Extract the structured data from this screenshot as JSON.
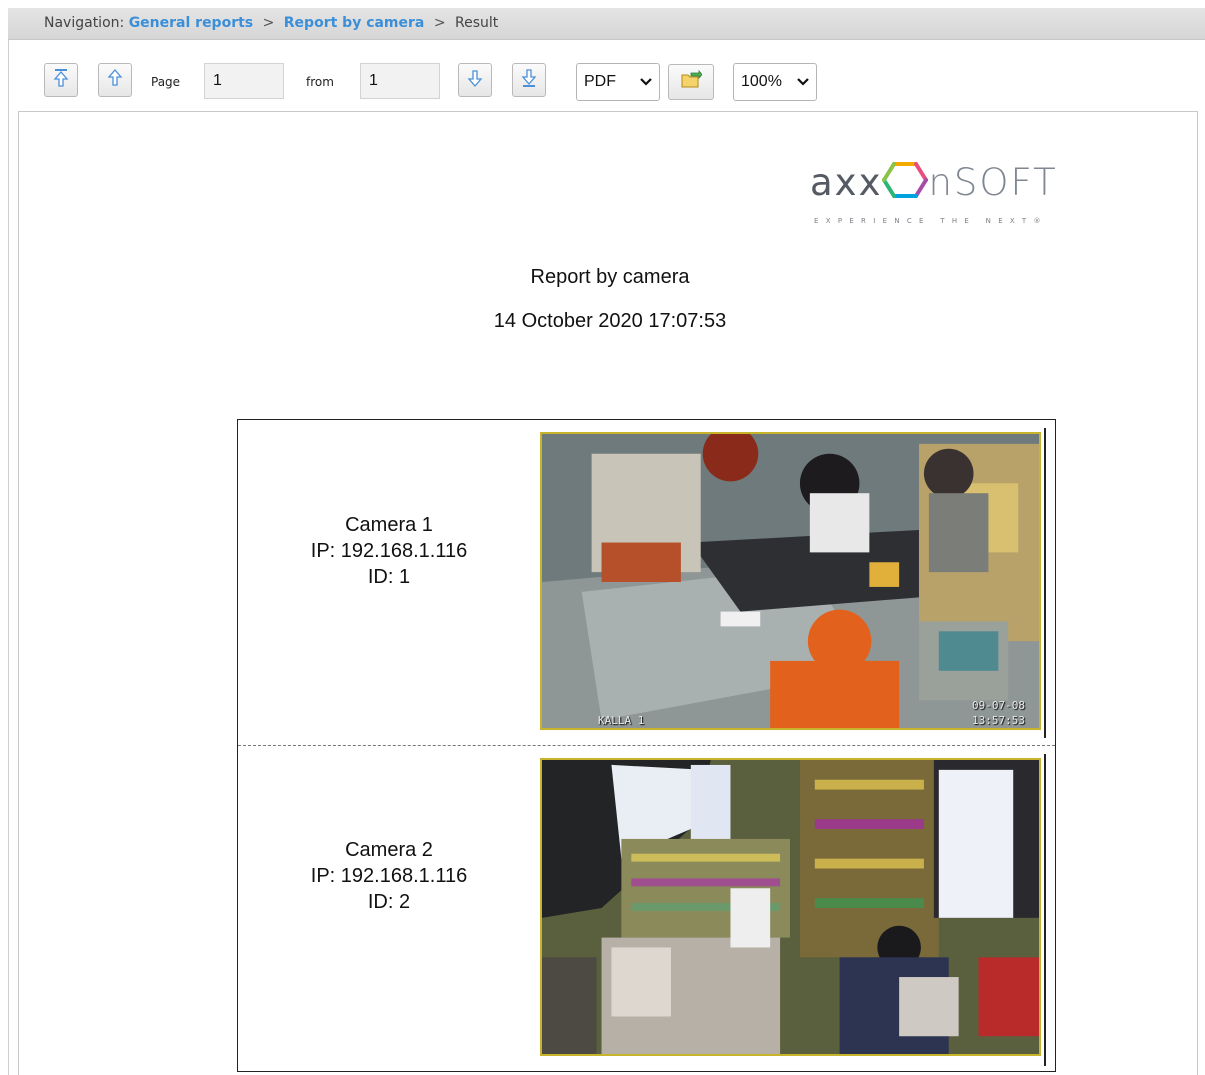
{
  "breadcrumb": {
    "prefix": "Navigation:",
    "items": [
      "General reports",
      "Report by camera"
    ],
    "current": "Result",
    "separator": ">"
  },
  "toolbar": {
    "page_label": "Page",
    "page_value": "1",
    "from_label": "from",
    "from_value": "1",
    "format_value": "PDF",
    "zoom_value": "100%"
  },
  "icons": {
    "first_page": "first-page-icon",
    "prev_page": "prev-page-icon",
    "next_page": "next-page-icon",
    "last_page": "last-page-icon",
    "export": "export-icon"
  },
  "logo": {
    "brand_dark": "axx",
    "brand_light": "nSOFT",
    "tagline": "EXPERIENCE THE NEXT®"
  },
  "report": {
    "title": "Report by camera",
    "date": "14 October 2020 17:07:53"
  },
  "cameras": [
    {
      "name": "Camera 1",
      "ip": "IP: 192.168.1.116",
      "id": "ID: 1",
      "osd_label": "KALLA 1",
      "osd_date": "09-07-08",
      "osd_time": "13:57:53"
    },
    {
      "name": "Camera 2",
      "ip": "IP: 192.168.1.116",
      "id": "ID: 2"
    }
  ],
  "colors": {
    "link": "#3b8fd9",
    "logo_hex_top": "#f2a900",
    "logo_hex_right": "#e84e7e",
    "logo_hex_left": "#8bc34a",
    "logo_hex_bottom": "#00a3e0",
    "snapshot_border": "#c8b42a"
  }
}
